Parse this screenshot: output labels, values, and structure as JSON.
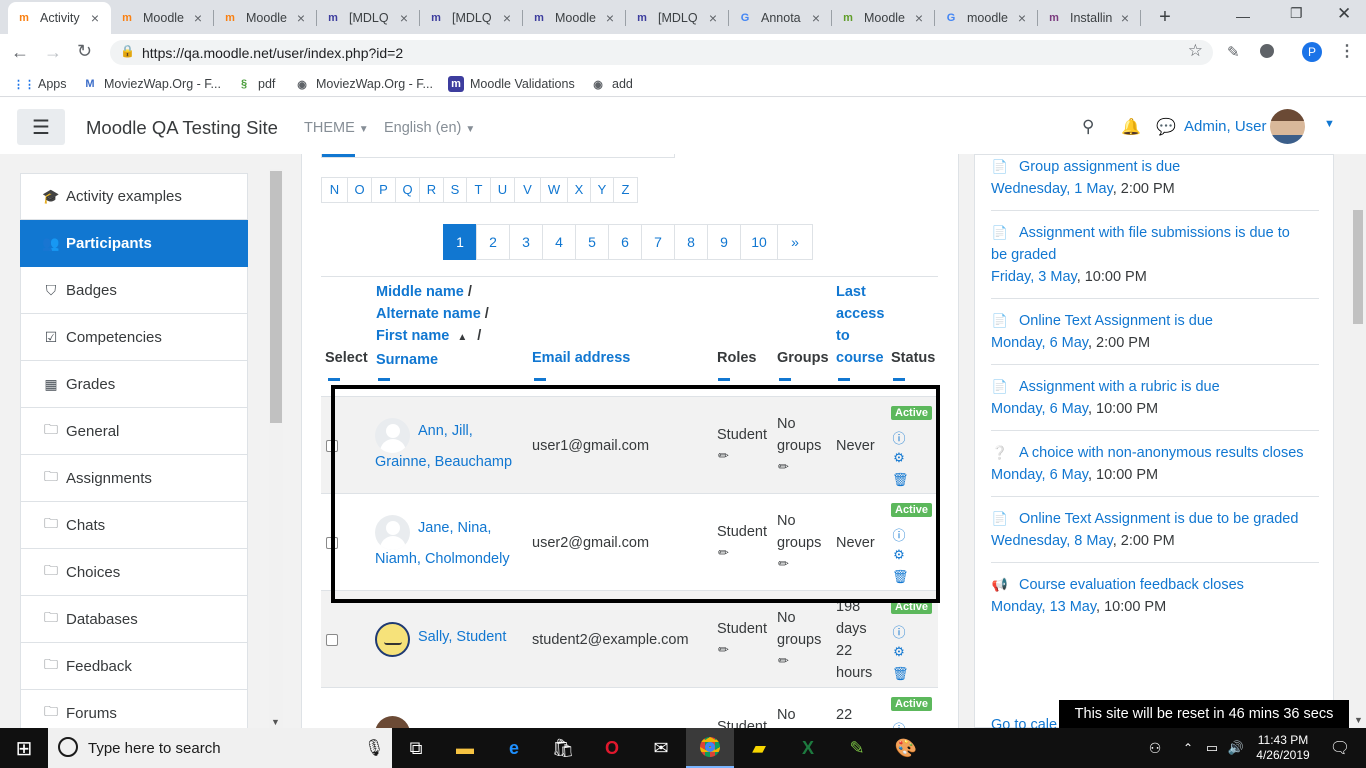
{
  "browser": {
    "tabs": [
      {
        "title": "Activity",
        "fav": "m",
        "fav_color": "#f98012",
        "active": true
      },
      {
        "title": "Moodle",
        "fav": "m",
        "fav_color": "#f98012"
      },
      {
        "title": "Moodle",
        "fav": "m",
        "fav_color": "#f98012"
      },
      {
        "title": "[MDLQ",
        "fav": "m",
        "fav_color": "#3d3d9e"
      },
      {
        "title": "[MDLQ",
        "fav": "m",
        "fav_color": "#3d3d9e"
      },
      {
        "title": "Moodle",
        "fav": "m",
        "fav_color": "#3d3d9e"
      },
      {
        "title": "[MDLQ",
        "fav": "m",
        "fav_color": "#3d3d9e"
      },
      {
        "title": "Annota",
        "fav": "G",
        "fav_color": "#4285f4"
      },
      {
        "title": "Moodle",
        "fav": "m",
        "fav_color": "#5f9d28"
      },
      {
        "title": "moodle",
        "fav": "G",
        "fav_color": "#4285f4"
      },
      {
        "title": "Installin",
        "fav": "m",
        "fav_color": "#7b3a7e"
      }
    ],
    "new_tab": "+",
    "url": "https://qa.moodle.net/user/index.php?id=2",
    "profile_initial": "P",
    "bookmarks": [
      {
        "label": "Apps"
      },
      {
        "label": "MoviezWap.Org - F..."
      },
      {
        "label": "pdf"
      },
      {
        "label": "MoviezWap.Org - F..."
      },
      {
        "label": "Moodle Validations"
      },
      {
        "label": "add"
      }
    ]
  },
  "header": {
    "site_name": "Moodle QA Testing Site",
    "theme_menu": "THEME",
    "language_menu": "English (en)",
    "user_name": "Admin, User"
  },
  "drawer": {
    "items": [
      {
        "label": "Activity examples",
        "icon": "graduation-cap-icon",
        "glyph": "🎓"
      },
      {
        "label": "Participants",
        "icon": "users-icon",
        "glyph": "👥",
        "active": true
      },
      {
        "label": "Badges",
        "icon": "shield-icon",
        "glyph": "⛉"
      },
      {
        "label": "Competencies",
        "icon": "check-square-icon",
        "glyph": "☑"
      },
      {
        "label": "Grades",
        "icon": "table-icon",
        "glyph": "▦"
      },
      {
        "label": "General",
        "icon": "folder-icon",
        "glyph": "🗀"
      },
      {
        "label": "Assignments",
        "icon": "folder-icon",
        "glyph": "🗀"
      },
      {
        "label": "Chats",
        "icon": "folder-icon",
        "glyph": "🗀"
      },
      {
        "label": "Choices",
        "icon": "folder-icon",
        "glyph": "🗀"
      },
      {
        "label": "Databases",
        "icon": "folder-icon",
        "glyph": "🗀"
      },
      {
        "label": "Feedback",
        "icon": "folder-icon",
        "glyph": "🗀"
      },
      {
        "label": "Forums",
        "icon": "folder-icon",
        "glyph": "🗀"
      }
    ]
  },
  "letters": [
    "N",
    "O",
    "P",
    "Q",
    "R",
    "S",
    "T",
    "U",
    "V",
    "W",
    "X",
    "Y",
    "Z"
  ],
  "pagination": [
    "1",
    "2",
    "3",
    "4",
    "5",
    "6",
    "7",
    "8",
    "9",
    "10",
    "»"
  ],
  "table": {
    "headers": {
      "select": "Select",
      "middle": "Middle name",
      "alternate": "Alternate name",
      "first": "First name",
      "surname": "Surname",
      "slash": "/",
      "sort_arrow": "▲",
      "email": "Email address",
      "roles": "Roles",
      "groups": "Groups",
      "last1": "Last",
      "last2": "access",
      "last3": "to",
      "last4": "course",
      "status": "Status"
    },
    "rows": [
      {
        "name1": "Ann, Jill,",
        "name2": "Grainne, Beauchamp",
        "email": "user1@gmail.com",
        "role": "Student",
        "groups1": "No",
        "groups2": "groups",
        "access": "Never",
        "status": "Active"
      },
      {
        "name1": "Jane, Nina,",
        "name2": "Niamh, Cholmondely",
        "email": "user2@gmail.com",
        "role": "Student",
        "groups1": "No",
        "groups2": "groups",
        "access": "Never",
        "status": "Active"
      },
      {
        "name1": "Sally, Student",
        "email": "student2@example.com",
        "role": "Student",
        "groups1": "No",
        "groups2": "groups",
        "access1": "198",
        "access2": "days",
        "access3": "22",
        "access4": "hours",
        "status": "Active"
      },
      {
        "role": "Student",
        "groups1": "No",
        "access1": "22",
        "status": "Active"
      }
    ]
  },
  "events": [
    {
      "name": "Group assignment is due",
      "date_link": "Wednesday, 1 May",
      "time": ", 2:00 PM",
      "icon": "assignment-icon"
    },
    {
      "name": "Assignment with file submissions is due to",
      "name2": "be graded",
      "date_link": "Friday, 3 May",
      "time": ", 10:00 PM",
      "icon": "assignment-icon"
    },
    {
      "name": "Online Text Assignment is due",
      "date_link": "Monday, 6 May",
      "time": ", 2:00 PM",
      "icon": "assignment-icon"
    },
    {
      "name": "Assignment with a rubric is due",
      "date_link": "Monday, 6 May",
      "time": ", 10:00 PM",
      "icon": "assignment-icon"
    },
    {
      "name": "A choice with non-anonymous results closes",
      "date_link": "Monday, 6 May",
      "time": ", 10:00 PM",
      "icon": "choice-icon"
    },
    {
      "name": "Online Text Assignment is due to be graded",
      "date_link": "Wednesday, 8 May",
      "time": ", 2:00 PM",
      "icon": "assignment-icon"
    },
    {
      "name": "Course evaluation feedback closes",
      "date_link": "Monday, 13 May",
      "time": ", 10:00 PM",
      "icon": "feedback-icon"
    }
  ],
  "goto_calendar": "Go to cale",
  "reset_notice": "This site will be reset in 46 mins 36 secs",
  "taskbar": {
    "search_placeholder": "Type here to search",
    "time": "11:43 PM",
    "date": "4/26/2019"
  },
  "colors": {
    "accent": "#1177d1",
    "active_badge": "#5cb85c",
    "highlight_box": "#000000"
  }
}
